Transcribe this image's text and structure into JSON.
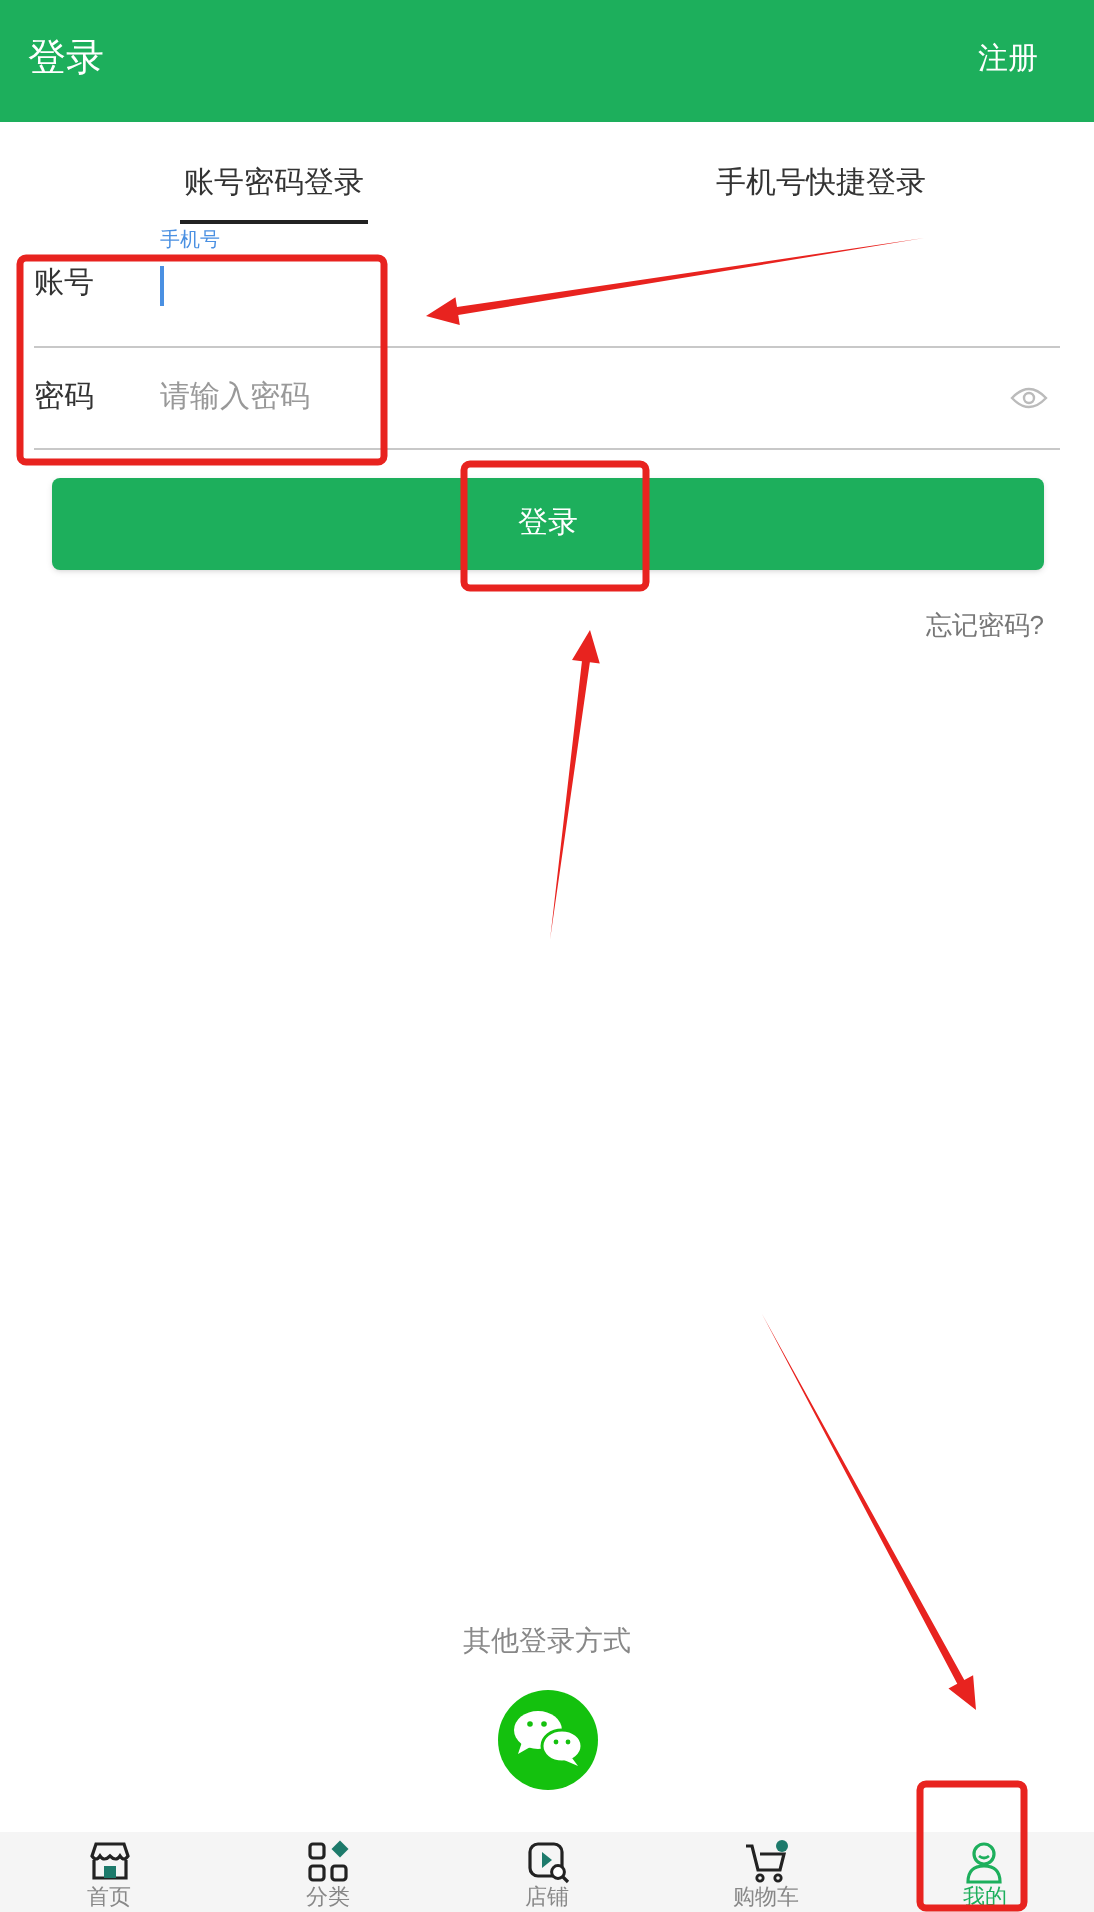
{
  "header": {
    "title": "登录",
    "action": "注册"
  },
  "tabs": [
    {
      "label": "账号密码登录",
      "selected": true
    },
    {
      "label": "手机号快捷登录",
      "selected": false
    }
  ],
  "form": {
    "account": {
      "label": "账号",
      "floating_label": "手机号",
      "focused": true
    },
    "password": {
      "label": "密码",
      "placeholder": "请输入密码"
    },
    "submit": "登录",
    "forgot": "忘记密码?"
  },
  "other_login": {
    "title": "其他登录方式"
  },
  "nav": [
    {
      "label": "首页",
      "selected": false
    },
    {
      "label": "分类",
      "selected": false
    },
    {
      "label": "店铺",
      "selected": false
    },
    {
      "label": "购物车",
      "selected": false
    },
    {
      "label": "我的",
      "selected": true
    }
  ],
  "annotations": [
    {
      "kind": "frame"
    },
    {
      "kind": "frame"
    },
    {
      "kind": "frame"
    },
    {
      "kind": "arrow"
    },
    {
      "kind": "arrow"
    },
    {
      "kind": "arrow"
    }
  ]
}
